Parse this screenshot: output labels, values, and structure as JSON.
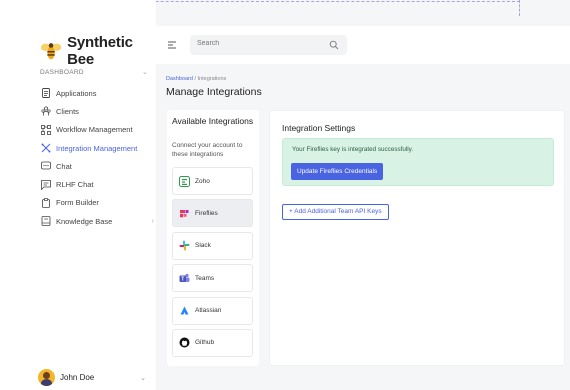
{
  "app": {
    "name": "Synthetic Bee"
  },
  "sidebar": {
    "section_label": "DASHBOARD",
    "items": [
      {
        "label": "Applications",
        "icon": "document-icon",
        "active": false
      },
      {
        "label": "Clients",
        "icon": "users-icon",
        "active": false
      },
      {
        "label": "Workflow Management",
        "icon": "workflow-icon",
        "active": false
      },
      {
        "label": "Integration Management",
        "icon": "integration-icon",
        "active": true
      },
      {
        "label": "Chat",
        "icon": "chat-icon",
        "active": false
      },
      {
        "label": "RLHF Chat",
        "icon": "message-icon",
        "active": false
      },
      {
        "label": "Form Builder",
        "icon": "clipboard-icon",
        "active": false
      },
      {
        "label": "Knowledge Base",
        "icon": "book-icon",
        "active": false
      }
    ],
    "user": {
      "name": "John Doe"
    }
  },
  "topbar": {
    "search_placeholder": "Search"
  },
  "breadcrumb": {
    "root": "Dashboard",
    "separator": "/",
    "current": "Integrations"
  },
  "page": {
    "title": "Manage Integrations"
  },
  "available": {
    "title": "Available Integrations",
    "subtitle": "Connect your account to these integrations",
    "items": [
      {
        "label": "Zoho",
        "icon": "zoho-icon",
        "active": false
      },
      {
        "label": "Fireflies",
        "icon": "fireflies-icon",
        "active": true
      },
      {
        "label": "Slack",
        "icon": "slack-icon",
        "active": false
      },
      {
        "label": "Teams",
        "icon": "teams-icon",
        "active": false
      },
      {
        "label": "Atlassian",
        "icon": "atlassian-icon",
        "active": false
      },
      {
        "label": "Github",
        "icon": "github-icon",
        "active": false
      }
    ]
  },
  "settings": {
    "title": "Integration Settings",
    "alert_text": "Your Fireflies key is integrated successfully.",
    "update_button": "Update Fireflies Credentials",
    "add_button": "+ Add Additional Team API Keys"
  },
  "colors": {
    "accent": "#4a63e0",
    "success_bg": "#d8f3e5"
  }
}
